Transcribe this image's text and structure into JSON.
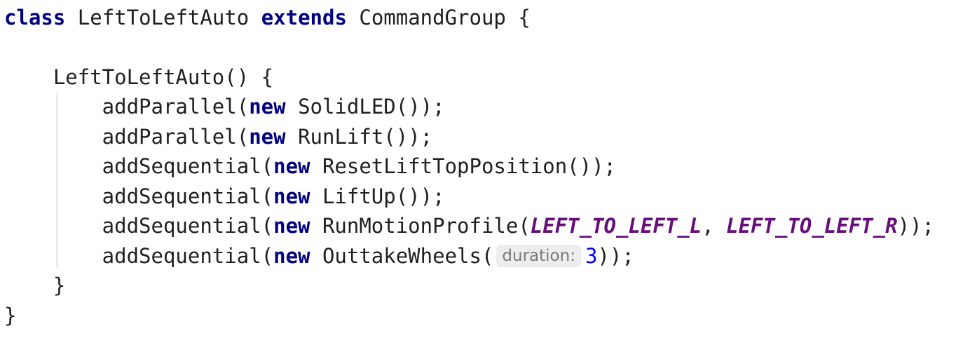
{
  "code": {
    "l1": {
      "kw_class": "class",
      "name": "LeftToLeftAuto",
      "kw_extends": "extends",
      "rest": "CommandGroup {"
    },
    "l3": {
      "text": "    LeftToLeftAuto() {"
    },
    "l4": {
      "a": "        addParallel(",
      "kw": "new",
      "b": "SolidLED());"
    },
    "l5": {
      "a": "        addParallel(",
      "kw": "new",
      "b": "RunLift());"
    },
    "l6": {
      "a": "        addSequential(",
      "kw": "new",
      "b": "ResetLiftTopPosition());"
    },
    "l7": {
      "a": "        addSequential(",
      "kw": "new",
      "b": "LiftUp());"
    },
    "l8": {
      "a": "        addSequential(",
      "kw": "new",
      "b": "RunMotionProfile(",
      "const1": "LEFT_TO_LEFT_L",
      "sep": ", ",
      "const2": "LEFT_TO_LEFT_R",
      "c": "));"
    },
    "l9": {
      "a": "        addSequential(",
      "kw": "new",
      "b": "OuttakeWheels(",
      "hint": "duration:",
      "num": "3",
      "c": "));"
    },
    "l10": {
      "text": "    }"
    },
    "l11": {
      "text": "}"
    }
  }
}
